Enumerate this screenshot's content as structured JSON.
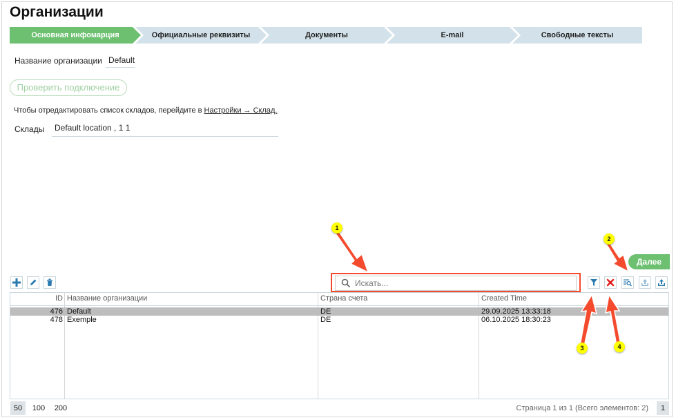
{
  "page_title": "Организации",
  "wizard": {
    "steps": [
      {
        "label": "Основная инфомарция",
        "active": true
      },
      {
        "label": "Официальные реквизиты",
        "active": false
      },
      {
        "label": "Документы",
        "active": false
      },
      {
        "label": "E-mail",
        "active": false
      },
      {
        "label": "Свободные тексты",
        "active": false
      }
    ]
  },
  "form": {
    "org_name_label": "Название организации",
    "org_name_value": "Default",
    "check_connection_label": "Проверить подключение",
    "warehouse_note_prefix": "Чтобы отредактировать список складов, перейдите в",
    "warehouse_note_link": "Настройки → Склад.",
    "warehouses_label": "Склады",
    "warehouses_value": "Default location , 1 1"
  },
  "next_label": "Далее",
  "toolbar": {
    "add_icon": "plus-icon",
    "edit_icon": "pencil-icon",
    "delete_icon": "trash-icon",
    "filter_icon": "filter-icon",
    "clear_filter_icon": "red-x-icon",
    "search_details_icon": "search-list-icon",
    "import_icon": "upload-tray-icon",
    "export_icon": "upload-tray-icon"
  },
  "search": {
    "placeholder": "Искать..."
  },
  "table": {
    "columns": [
      "ID",
      "Название организации",
      "Страна счета",
      "Created Time"
    ],
    "rows": [
      {
        "id": "476",
        "name": "Default",
        "country": "DE",
        "created": "29.09.2025 13:33:18",
        "selected": true
      },
      {
        "id": "478",
        "name": "Exemple",
        "country": "DE",
        "created": "06.10.2025 18:30:23",
        "selected": false
      }
    ]
  },
  "pager": {
    "sizes": [
      "50",
      "100",
      "200"
    ],
    "current_size": "50",
    "info": "Страница 1 из 1 (Всего элементов: 2)",
    "page": "1"
  },
  "annotations": [
    "1",
    "2",
    "3",
    "4"
  ],
  "colors": {
    "accent_green": "#6cc070",
    "step_inactive": "#d3e2ea",
    "annotation_red": "#f44a2d",
    "badge_yellow": "#ffff00",
    "toolbar_blue": "#2a7ab0"
  }
}
